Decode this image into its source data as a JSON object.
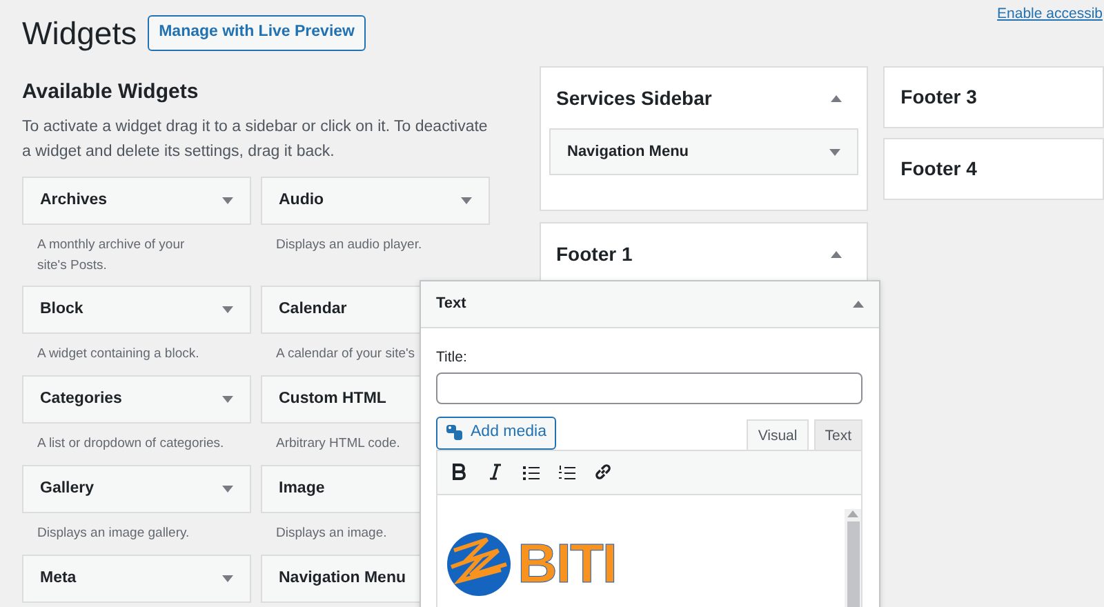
{
  "header": {
    "title": "Widgets",
    "button": "Manage with Live Preview",
    "accessibility_link": "Enable accessib"
  },
  "available_widgets": {
    "heading": "Available Widgets",
    "description": "To activate a widget drag it to a sidebar or click on it. To deactivate a widget and delete its settings, drag it back.",
    "widgets": [
      {
        "name": "Archives",
        "description": "A monthly archive of your site's Posts."
      },
      {
        "name": "Audio",
        "description": "Displays an audio player."
      },
      {
        "name": "Block",
        "description": "A widget containing a block."
      },
      {
        "name": "Calendar",
        "description": "A calendar of your site's"
      },
      {
        "name": "Categories",
        "description": "A list or dropdown of categories."
      },
      {
        "name": "Custom HTML",
        "description": "Arbitrary HTML code."
      },
      {
        "name": "Gallery",
        "description": "Displays an image gallery."
      },
      {
        "name": "Image",
        "description": "Displays an image."
      },
      {
        "name": "Meta"
      },
      {
        "name": "Navigation Menu"
      }
    ]
  },
  "sidebars": [
    {
      "title": "Services Sidebar",
      "expanded": true,
      "widgets": [
        {
          "name": "Navigation Menu"
        }
      ]
    },
    {
      "title": "Footer 1",
      "expanded": true
    }
  ],
  "sidebars_right": [
    {
      "title": "Footer 3"
    },
    {
      "title": "Footer 4"
    }
  ],
  "dragged_widget": {
    "title": "Text",
    "expanded": true,
    "title_label": "Title:",
    "add_media": "Add media",
    "editor_tabs": [
      {
        "label": "Visual",
        "selected": true
      },
      {
        "label": "Text",
        "selected": false
      }
    ],
    "logo_text": "BITI"
  }
}
